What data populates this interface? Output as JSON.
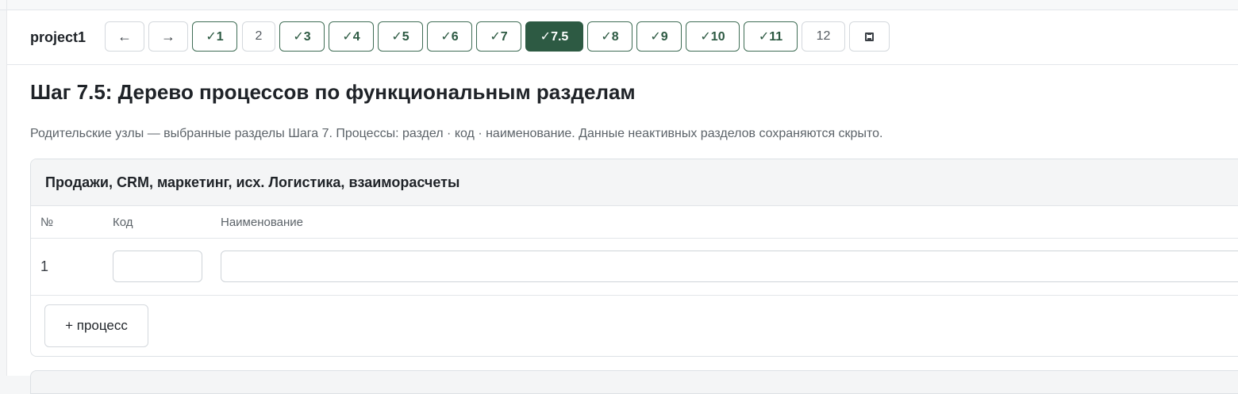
{
  "project": "project1",
  "stepbar": {
    "back_label": "←",
    "forward_label": "→",
    "steps": [
      {
        "label": "✓1",
        "state": "done"
      },
      {
        "label": "2",
        "state": "todo"
      },
      {
        "label": "✓3",
        "state": "done"
      },
      {
        "label": "✓4",
        "state": "done"
      },
      {
        "label": "✓5",
        "state": "done"
      },
      {
        "label": "✓6",
        "state": "done"
      },
      {
        "label": "✓7",
        "state": "done"
      },
      {
        "label": "✓7.5",
        "state": "active"
      },
      {
        "label": "✓8",
        "state": "done"
      },
      {
        "label": "✓9",
        "state": "done"
      },
      {
        "label": "✓10",
        "state": "done"
      },
      {
        "label": "✓11",
        "state": "done"
      },
      {
        "label": "12",
        "state": "todo"
      }
    ],
    "save_icon": "save-icon"
  },
  "page": {
    "title": "Шаг 7.5: Дерево процессов по функциональным разделам",
    "subtitle": "Родительские узлы — выбранные разделы Шага 7. Процессы: раздел · код · наименование. Данные неактивных разделов сохраняются скрыто."
  },
  "section": {
    "title": "Продажи, CRM, маркетинг, исх. Логистика, взаиморасчеты",
    "columns": {
      "num": "№",
      "code": "Код",
      "name": "Наименование"
    },
    "rows": [
      {
        "num": "1",
        "code": "",
        "name": ""
      }
    ],
    "add_label": "+ процесс"
  },
  "colors": {
    "accent": "#2d5a43",
    "accent_border": "#3f6d55",
    "border": "#d4d8dd"
  }
}
